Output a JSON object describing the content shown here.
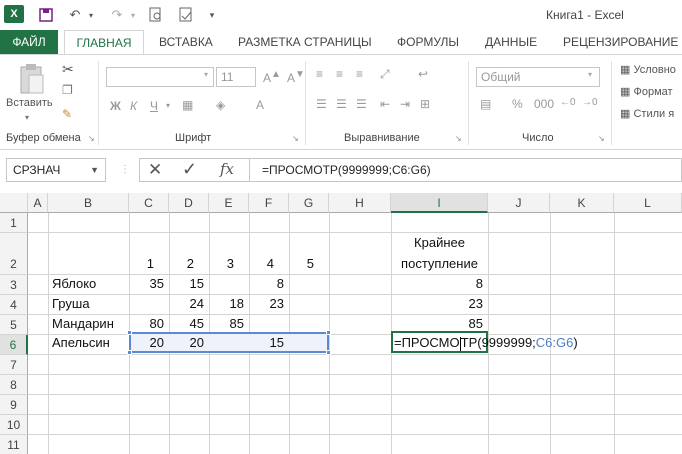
{
  "window": {
    "title": "Книга1 - Excel",
    "logo": "X"
  },
  "tabs": [
    {
      "label": "ФАЙЛ"
    },
    {
      "label": "ГЛАВНАЯ"
    },
    {
      "label": "ВСТАВКА"
    },
    {
      "label": "РАЗМЕТКА СТРАНИЦЫ"
    },
    {
      "label": "ФОРМУЛЫ"
    },
    {
      "label": "ДАННЫЕ"
    },
    {
      "label": "РЕЦЕНЗИРОВАНИЕ"
    }
  ],
  "ribbon": {
    "paste_label": "Вставить",
    "font_size": "11",
    "number_format": "Общий",
    "bold": "Ж",
    "italic": "К",
    "underline": "Ч",
    "groups": [
      "Буфер обмена",
      "Шрифт",
      "Выравнивание",
      "Число"
    ],
    "styles": [
      "Условно",
      "Формат",
      "Стили я"
    ]
  },
  "formula_bar": {
    "name_box": "СРЗНАЧ",
    "cancel": "✕",
    "enter": "✓",
    "fx": "fx",
    "formula": "=ПРОСМОТР(9999999;C6:G6)"
  },
  "columns": [
    "A",
    "B",
    "C",
    "D",
    "E",
    "F",
    "G",
    "H",
    "I",
    "J",
    "K",
    "L"
  ],
  "rows": [
    "1",
    "2",
    "3",
    "4",
    "5",
    "6",
    "7",
    "8",
    "9",
    "10",
    "11"
  ],
  "cells": {
    "C2": "1",
    "D2": "2",
    "E2": "3",
    "F2": "4",
    "G2": "5",
    "I1": "Крайнее",
    "I2": "поступление",
    "B3": "Яблоко",
    "C3": "35",
    "D3": "15",
    "F3": "8",
    "I3": "8",
    "B4": "Груша",
    "D4": "24",
    "E4": "18",
    "F4": "23",
    "I4": "23",
    "B5": "Мандарин",
    "C5": "80",
    "D5": "45",
    "E5": "85",
    "I5": "85",
    "B6": "Апельсин",
    "C6": "20",
    "D6": "20",
    "F6": "15"
  },
  "edit": {
    "prefix": "=ПРОСМО",
    "middle": "ТР(9999999;",
    "ref": "C6:G6",
    "suffix": ")"
  }
}
